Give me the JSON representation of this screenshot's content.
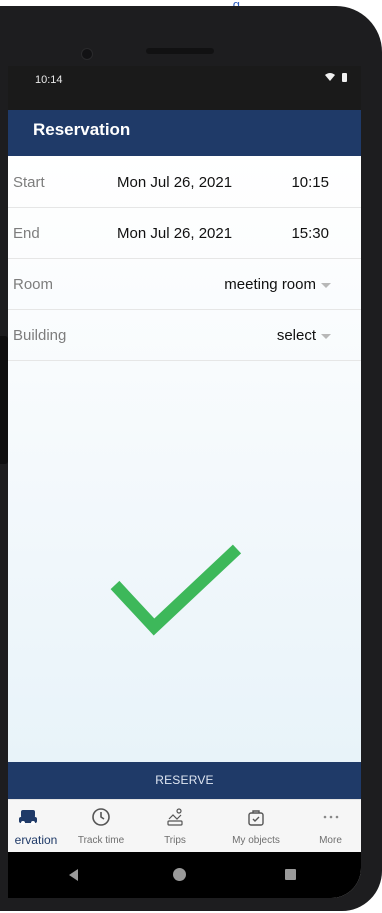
{
  "top_caption": "g",
  "status_bar": {
    "time": "10:14"
  },
  "app_bar": {
    "title": "Reservation"
  },
  "form": {
    "start": {
      "label": "Start",
      "date": "Mon Jul 26, 2021",
      "time": "10:15"
    },
    "end": {
      "label": "End",
      "date": "Mon Jul 26, 2021",
      "time": "15:30"
    },
    "room": {
      "label": "Room",
      "value": "meeting room"
    },
    "building": {
      "label": "Building",
      "value": "select"
    }
  },
  "success_icon": "checkmark-icon",
  "reserve_button": {
    "label": "RESERVE"
  },
  "bottom_nav": {
    "items": [
      {
        "label": "ervation",
        "icon": "car-icon",
        "active": true
      },
      {
        "label": "Track time",
        "icon": "clock-icon",
        "active": false
      },
      {
        "label": "Trips",
        "icon": "trip-icon",
        "active": false
      },
      {
        "label": "My objects",
        "icon": "bag-icon",
        "active": false
      },
      {
        "label": "More",
        "icon": "more-icon",
        "active": false
      }
    ]
  },
  "colors": {
    "brand": "#1f3a68",
    "success": "#3db85a",
    "text_primary": "#111111",
    "text_secondary": "#7d7d7d"
  }
}
